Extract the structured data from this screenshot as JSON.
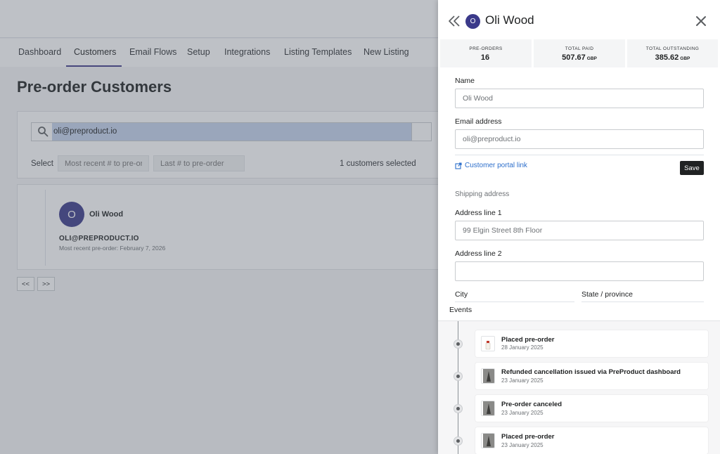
{
  "nav": {
    "tabs": [
      "Dashboard",
      "Customers",
      "Email Flows",
      "Setup",
      "Integrations",
      "Listing Templates",
      "New Listing"
    ],
    "active": "Customers"
  },
  "page": {
    "title": "Pre-order Customers",
    "search_value": "oli@preproduct.io",
    "select_label": "Select",
    "filter_recent_placeholder": "Most recent # to pre-on",
    "filter_last_placeholder": "Last # to pre-order",
    "selected_count": "1 customers selected"
  },
  "customer_card": {
    "avatar_initial": "O",
    "name": "Oli Wood",
    "email": "OLI@PREPRODUCT.IO",
    "recent": "Most recent pre-order: February 7, 2026"
  },
  "pager": {
    "prev": "<<",
    "next": ">>"
  },
  "panel": {
    "avatar_initial": "O",
    "title": "Oli Wood",
    "stats": [
      {
        "label": "PRE-ORDERS",
        "value": "16",
        "currency": ""
      },
      {
        "label": "TOTAL PAID",
        "value": "507.67",
        "currency": "GBP"
      },
      {
        "label": "TOTAL OUTSTANDING",
        "value": "385.62",
        "currency": "GBP"
      }
    ],
    "form": {
      "name_label": "Name",
      "name_value": "Oli Wood",
      "email_label": "Email address",
      "email_value": "oli@preproduct.io",
      "portal_link": "Customer portal link",
      "save_label": "Save",
      "shipping_title": "Shipping address",
      "address1_label": "Address line 1",
      "address1_value": "99 Elgin Street 8th Floor",
      "address2_label": "Address line 2",
      "address2_value": "",
      "city_label": "City",
      "state_label": "State / province"
    },
    "events_label": "Events",
    "events": [
      {
        "title": "Placed pre-order",
        "date": "28 January 2025",
        "thumb": "product-photo-white"
      },
      {
        "title": "Refunded cancellation issued via PreProduct dashboard",
        "date": "23 January 2025",
        "thumb": "product-photo-dark"
      },
      {
        "title": "Pre-order canceled",
        "date": "23 January 2025",
        "thumb": "product-photo-dark"
      },
      {
        "title": "Placed pre-order",
        "date": "23 January 2025",
        "thumb": "product-photo-dark"
      }
    ]
  },
  "colors": {
    "accent": "#3b3a8a",
    "link": "#2c6ecb",
    "primary_button": "#202223",
    "overlay": "rgba(84,92,104,0.38)"
  }
}
